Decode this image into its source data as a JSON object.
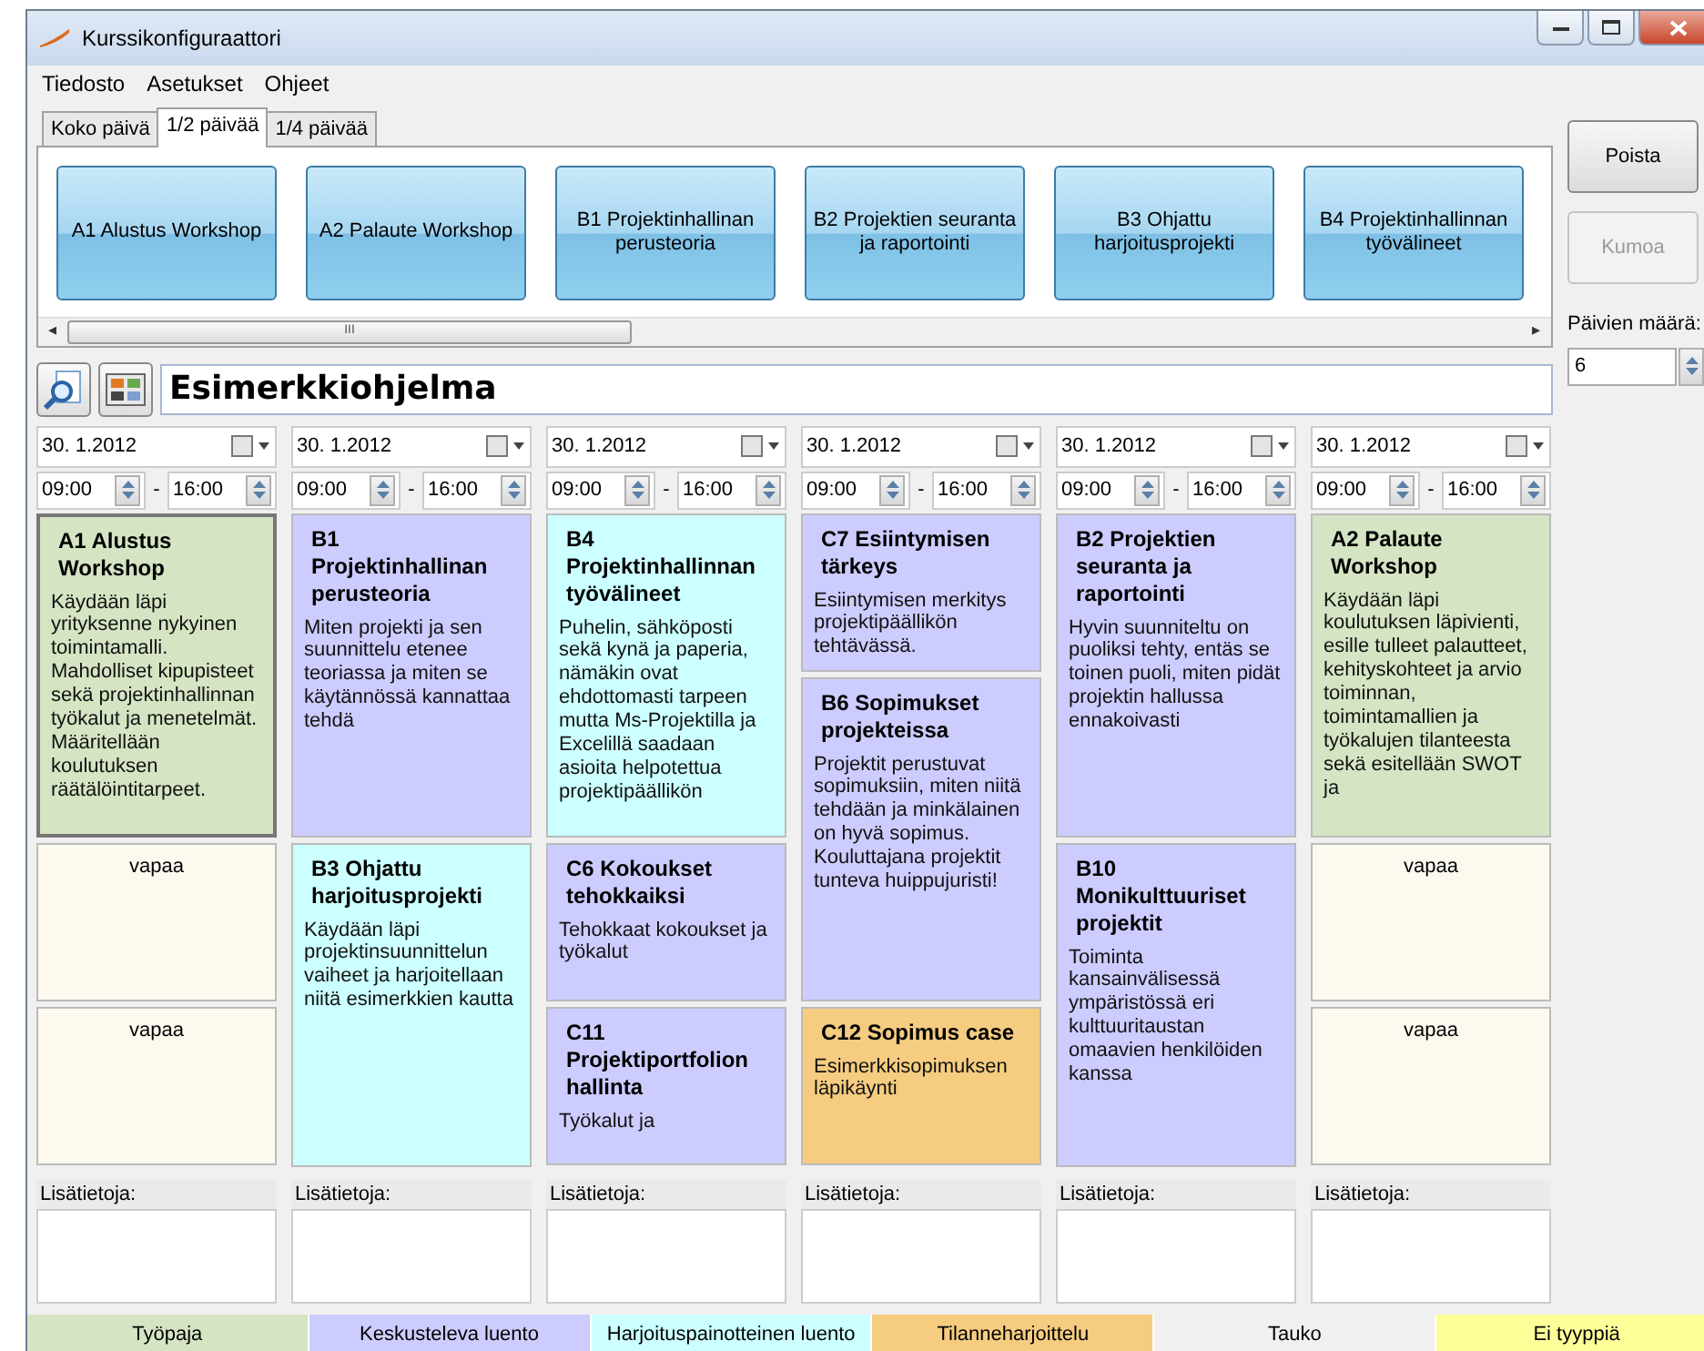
{
  "window": {
    "title": "Kurssikonfiguraattori"
  },
  "menu": [
    "Tiedosto",
    "Asetukset",
    "Ohjeet"
  ],
  "palette_tabs": [
    {
      "label": "Koko päivä",
      "selected": false
    },
    {
      "label": "1/2 päivää",
      "selected": true
    },
    {
      "label": "1/4 päivää",
      "selected": false
    }
  ],
  "palette_items": [
    "A1 Alustus Workshop",
    "A2 Palaute Workshop",
    "B1 Projektinhallinan perusteoria",
    "B2 Projektien seuranta ja raportointi",
    "B3 Ohjattu harjoitusprojekti",
    "B4 Projektinhallinnan työvälineet"
  ],
  "scroll_arrows": [
    "◂",
    "III",
    "▸"
  ],
  "actions": [
    {
      "label": "Poista",
      "disabled": false
    },
    {
      "label": "Kumoa",
      "disabled": true
    }
  ],
  "day_count": {
    "label": "Päivien määrä:",
    "value": "6"
  },
  "program_name": "Esimerkkiohjelma",
  "days": [
    {
      "date": "30. 1.2012",
      "start": "09:00",
      "separator": "-",
      "end": "16:00",
      "notes_label": "Lisätietoja:",
      "sessions": [
        {
          "kind": "session",
          "half": true,
          "color": "#d5e4c3",
          "selected": true,
          "title": "A1 Alustus Workshop",
          "description": "Käydään läpi yrityksenne nykyinen toimintamalli. Mahdolliset kipupisteet sekä projektinhallinnan työkalut ja menetelmät. Määritellään koulutuksen räätälöintitarpeet."
        },
        {
          "kind": "free",
          "half": false,
          "color": "#fdf9ef",
          "selected": false,
          "title": "vapaa"
        },
        {
          "kind": "free",
          "half": false,
          "color": "#fdf9ef",
          "selected": false,
          "title": "vapaa"
        }
      ]
    },
    {
      "date": "30. 1.2012",
      "start": "09:00",
      "separator": "-",
      "end": "16:00",
      "notes_label": "Lisätietoja:",
      "sessions": [
        {
          "kind": "session",
          "half": true,
          "color": "#ccccff",
          "selected": false,
          "title": "B1 Projektinhallinan perusteoria",
          "description": "Miten projekti ja sen suunnittelu etenee teoriassa ja miten se käytännössä kannattaa tehdä"
        },
        {
          "kind": "session",
          "half": true,
          "color": "#ccffff",
          "selected": false,
          "title": "B3 Ohjattu harjoitusprojekti",
          "description": "Käydään läpi projektinsuunnittelun vaiheet ja harjoitellaan niitä esimerkkien kautta"
        }
      ]
    },
    {
      "date": "30. 1.2012",
      "start": "09:00",
      "separator": "-",
      "end": "16:00",
      "notes_label": "Lisätietoja:",
      "sessions": [
        {
          "kind": "session",
          "half": true,
          "color": "#ccffff",
          "selected": false,
          "title": "B4 Projektinhallinnan työvälineet",
          "description": "Puhelin, sähköposti sekä kynä ja paperia, nämäkin ovat ehdottomasti tarpeen mutta Ms-Projektilla ja Excelillä saadaan asioita helpotettua projektipäällikön"
        },
        {
          "kind": "session",
          "half": false,
          "color": "#ccccff",
          "selected": false,
          "title": "C6 Kokoukset tehokkaiksi",
          "description": "Tehokkaat kokoukset ja työkalut"
        },
        {
          "kind": "session",
          "half": false,
          "color": "#ccccff",
          "selected": false,
          "title": "C11 Projektiportfolion hallinta",
          "description": "Työkalut ja"
        }
      ]
    },
    {
      "date": "30. 1.2012",
      "start": "09:00",
      "separator": "-",
      "end": "16:00",
      "notes_label": "Lisätietoja:",
      "sessions": [
        {
          "kind": "session",
          "half": false,
          "color": "#ccccff",
          "selected": false,
          "title": "C7 Esiintymisen tärkeys",
          "description": "Esiintymisen merkitys projektipäällikön tehtävässä."
        },
        {
          "kind": "session",
          "half": true,
          "color": "#ccccff",
          "selected": false,
          "title": "B6 Sopimukset projekteissa",
          "description": "Projektit perustuvat sopimuksiin, miten niitä tehdään ja minkälainen on hyvä sopimus. Kouluttajana projektit tunteva huippujuristi!"
        },
        {
          "kind": "session",
          "half": false,
          "color": "#f5cc80",
          "selected": false,
          "title": "C12 Sopimus case",
          "description": "Esimerkkisopimuksen läpikäynti"
        }
      ]
    },
    {
      "date": "30. 1.2012",
      "start": "09:00",
      "separator": "-",
      "end": "16:00",
      "notes_label": "Lisätietoja:",
      "sessions": [
        {
          "kind": "session",
          "half": true,
          "color": "#ccccff",
          "selected": false,
          "title": "B2 Projektien seuranta ja raportointi",
          "description": "Hyvin suunniteltu on puoliksi tehty, entäs se toinen puoli, miten pidät projektin hallussa ennakoivasti"
        },
        {
          "kind": "session",
          "half": true,
          "color": "#ccccff",
          "selected": false,
          "title": "B10 Monikulttuuriset projektit",
          "description": "Toiminta kansainvälisessä ympäristössä eri kulttuuritaustan omaavien henkilöiden kanssa"
        }
      ]
    },
    {
      "date": "30. 1.2012",
      "start": "09:00",
      "separator": "-",
      "end": "16:00",
      "notes_label": "Lisätietoja:",
      "sessions": [
        {
          "kind": "session",
          "half": true,
          "color": "#d5e4c3",
          "selected": false,
          "title": "A2 Palaute Workshop",
          "description": "Käydään läpi koulutuksen läpivienti, esille tulleet palautteet, kehityskohteet ja arvio toiminnan, toimintamallien ja työkalujen tilanteesta sekä esitellään SWOT ja"
        },
        {
          "kind": "free",
          "half": false,
          "color": "#fdf9ef",
          "selected": false,
          "title": "vapaa"
        },
        {
          "kind": "free",
          "half": false,
          "color": "#fdf9ef",
          "selected": false,
          "title": "vapaa"
        }
      ]
    }
  ],
  "legend": [
    {
      "label": "Työpaja",
      "color": "#d5e4c3"
    },
    {
      "label": "Keskusteleva luento",
      "color": "#ccccff"
    },
    {
      "label": "Harjoituspainotteinen luento",
      "color": "#ccffff"
    },
    {
      "label": "Tilanneharjoittelu",
      "color": "#f5cc80"
    },
    {
      "label": "Tauko",
      "color": "#f0f0f0"
    },
    {
      "label": "Ei tyyppiä",
      "color": "#ffff99"
    }
  ]
}
